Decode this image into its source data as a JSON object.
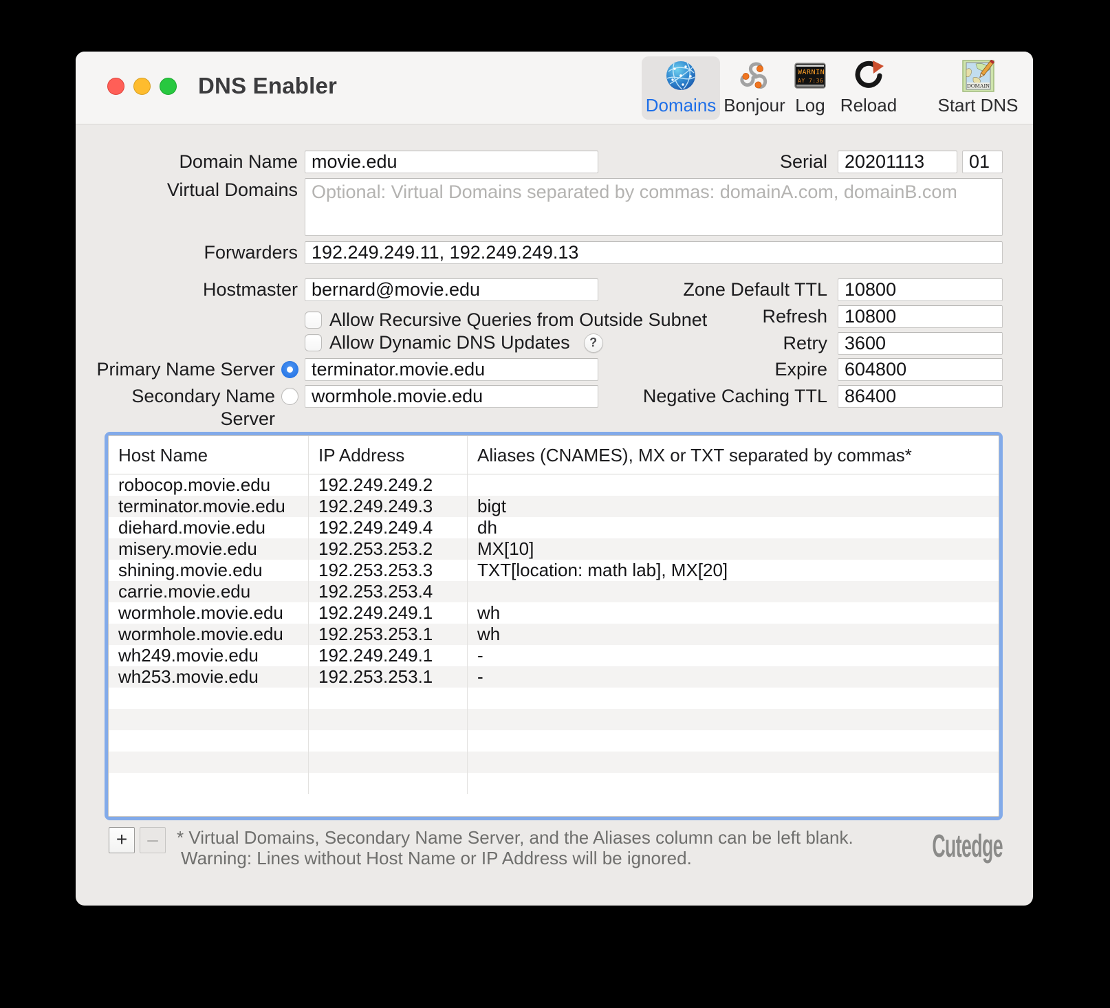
{
  "window": {
    "title": "DNS Enabler"
  },
  "toolbar": {
    "items": [
      {
        "label": "Domains",
        "icon": "globe-network-icon",
        "selected": true
      },
      {
        "label": "Bonjour",
        "icon": "bonjour-icon",
        "selected": false
      },
      {
        "label": "Log",
        "icon": "led-ticker-icon",
        "selected": false
      },
      {
        "label": "Reload",
        "icon": "reload-arrow-icon",
        "selected": false
      },
      {
        "label": "Start DNS",
        "icon": "domain-map-icon",
        "selected": false
      }
    ]
  },
  "form": {
    "domain_name": {
      "label": "Domain Name",
      "value": "movie.edu"
    },
    "serial": {
      "label": "Serial",
      "value": "20201113",
      "value2": "01"
    },
    "virtual_domains": {
      "label": "Virtual Domains",
      "value": "",
      "placeholder": "Optional: Virtual Domains separated by commas: domainA.com, domainB.com"
    },
    "forwarders": {
      "label": "Forwarders",
      "value": "192.249.249.11, 192.249.249.13"
    },
    "hostmaster": {
      "label": "Hostmaster",
      "value": "bernard@movie.edu"
    },
    "zone_default_ttl": {
      "label": "Zone Default TTL",
      "value": "10800"
    },
    "allow_recursive": {
      "label": "Allow Recursive Queries from Outside Subnet",
      "checked": false
    },
    "allow_dynamic": {
      "label": "Allow Dynamic DNS Updates",
      "checked": false
    },
    "help_button": "?",
    "refresh": {
      "label": "Refresh",
      "value": "10800"
    },
    "retry": {
      "label": "Retry",
      "value": "3600"
    },
    "primary_ns": {
      "label": "Primary Name Server",
      "value": "terminator.movie.edu",
      "selected": true
    },
    "expire": {
      "label": "Expire",
      "value": "604800"
    },
    "secondary_ns": {
      "label": "Secondary Name Server",
      "value": "wormhole.movie.edu",
      "selected": false
    },
    "negative_caching_ttl": {
      "label": "Negative Caching TTL",
      "value": "86400"
    }
  },
  "hosts_table": {
    "columns": [
      "Host Name",
      "IP Address",
      "Aliases (CNAMES), MX or TXT separated by commas*"
    ],
    "rows": [
      [
        "robocop.movie.edu",
        "192.249.249.2",
        ""
      ],
      [
        "terminator.movie.edu",
        "192.249.249.3",
        "bigt"
      ],
      [
        "diehard.movie.edu",
        "192.249.249.4",
        "dh"
      ],
      [
        "misery.movie.edu",
        "192.253.253.2",
        "MX[10]"
      ],
      [
        "shining.movie.edu",
        "192.253.253.3",
        "TXT[location: math lab], MX[20]"
      ],
      [
        "carrie.movie.edu",
        "192.253.253.4",
        ""
      ],
      [
        "wormhole.movie.edu",
        "192.249.249.1",
        "wh"
      ],
      [
        "wormhole.movie.edu",
        "192.253.253.1",
        "wh"
      ],
      [
        "wh249.movie.edu",
        "192.249.249.1",
        "-"
      ],
      [
        "wh253.movie.edu",
        "192.253.253.1",
        "-"
      ]
    ],
    "empty_rows": 5
  },
  "footer": {
    "add_button": "+",
    "remove_button": "–",
    "note_line1": "* Virtual Domains, Secondary Name Server, and the Aliases column can be left blank.",
    "note_line2": "Warning: Lines without Host Name or IP Address will be ignored.",
    "brand": "Cutedge"
  },
  "colors": {
    "accent_blue": "#1e6fe8",
    "focus_ring": "#82aae9",
    "traffic_red": "#ff5f57",
    "traffic_yellow": "#febc2e",
    "traffic_green": "#28c840",
    "titlebar_bg": "#f6f5f4",
    "content_bg": "#eceae8",
    "stripe": "#f4f3f2"
  }
}
